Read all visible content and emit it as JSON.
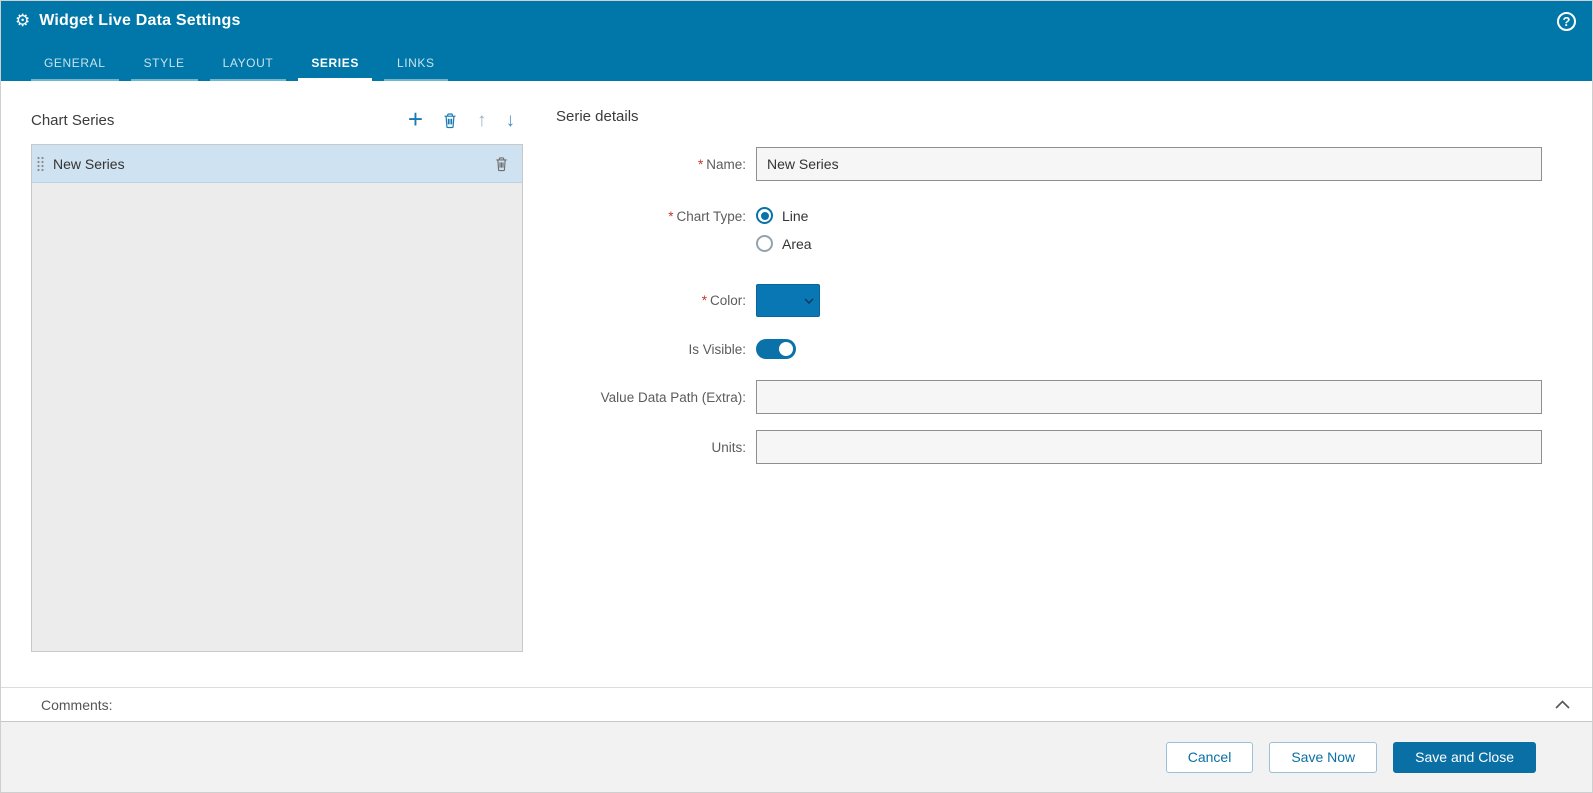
{
  "header": {
    "title": "Widget Live Data Settings",
    "tabs": [
      {
        "label": "GENERAL",
        "active": false
      },
      {
        "label": "STYLE",
        "active": false
      },
      {
        "label": "LAYOUT",
        "active": false
      },
      {
        "label": "SERIES",
        "active": true
      },
      {
        "label": "LINKS",
        "active": false
      }
    ]
  },
  "series_panel": {
    "title": "Chart Series",
    "items": [
      {
        "label": "New Series",
        "selected": true
      }
    ]
  },
  "details": {
    "title": "Serie details",
    "required_marker": "*",
    "name": {
      "label": "Name:",
      "required": true,
      "value": "New Series"
    },
    "chart_type": {
      "label": "Chart Type:",
      "required": true,
      "options": [
        {
          "label": "Line",
          "selected": true
        },
        {
          "label": "Area",
          "selected": false
        }
      ]
    },
    "color": {
      "label": "Color:",
      "required": true,
      "value": "#0a77b5"
    },
    "is_visible": {
      "label": "Is Visible:",
      "value": true
    },
    "value_data_path": {
      "label": "Value Data Path (Extra):",
      "value": ""
    },
    "units": {
      "label": "Units:",
      "value": ""
    }
  },
  "comments": {
    "label": "Comments:"
  },
  "footer": {
    "buttons": [
      {
        "label": "Cancel",
        "primary": false
      },
      {
        "label": "Save Now",
        "primary": false
      },
      {
        "label": "Save and Close",
        "primary": true
      }
    ]
  },
  "colors": {
    "header": "#0077a8",
    "accent": "#0a6fa4",
    "selected_row": "#cfe2f1",
    "required": "#c0392b"
  }
}
